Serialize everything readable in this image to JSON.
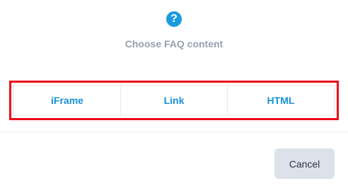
{
  "header": {
    "icon": "question-circle-icon",
    "icon_glyph": "?",
    "subtitle": "Choose FAQ content"
  },
  "options": [
    {
      "label": "iFrame"
    },
    {
      "label": "Link"
    },
    {
      "label": "HTML"
    }
  ],
  "footer": {
    "cancel_label": "Cancel"
  },
  "colors": {
    "accent": "#1a9be0",
    "highlight": "#ee0a18",
    "subtitle": "#9aa0ae",
    "cancel_bg": "#dde1ea"
  }
}
